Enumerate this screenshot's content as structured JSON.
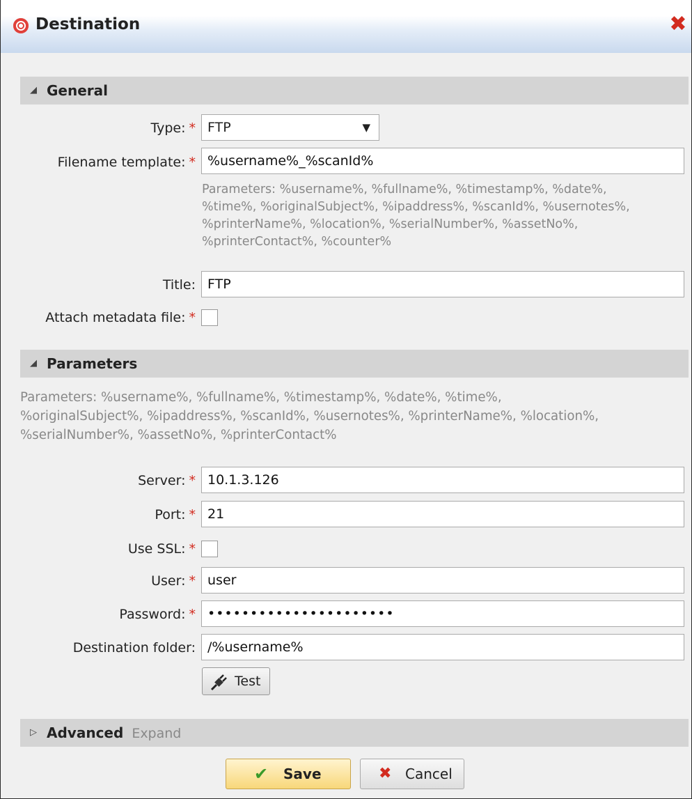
{
  "window": {
    "title": "Destination",
    "close_glyph": "✖"
  },
  "icons": {
    "title": "target-icon",
    "close": "close-icon",
    "test": "plug-icon",
    "save": "check-icon",
    "cancel": "x-icon"
  },
  "colors": {
    "required": "#d22b1f",
    "save_bg": "#f8d77a",
    "section_bg": "#d4d4d4"
  },
  "general": {
    "header": "General",
    "type": {
      "label": "Type:",
      "value": "FTP"
    },
    "filename_template": {
      "label": "Filename template:",
      "value": "%username%_%scanId%",
      "hint_lines": [
        "Parameters: %username%, %fullname%, %timestamp%, %date%,",
        "%time%, %originalSubject%, %ipaddress%, %scanId%, %usernotes%,",
        "%printerName%, %location%, %serialNumber%, %assetNo%,",
        "%printerContact%, %counter%"
      ]
    },
    "title": {
      "label": "Title:",
      "value": "FTP"
    },
    "attach_metadata": {
      "label": "Attach metadata file:",
      "checked": false
    }
  },
  "parameters": {
    "header": "Parameters",
    "hint_lines": [
      "Parameters: %username%, %fullname%, %timestamp%, %date%, %time%,",
      "%originalSubject%, %ipaddress%, %scanId%, %usernotes%, %printerName%, %location%,",
      "%serialNumber%, %assetNo%, %printerContact%"
    ],
    "server": {
      "label": "Server:",
      "value": "10.1.3.126"
    },
    "port": {
      "label": "Port:",
      "value": "21"
    },
    "use_ssl": {
      "label": "Use SSL:",
      "checked": false
    },
    "user": {
      "label": "User:",
      "value": "user"
    },
    "password": {
      "label": "Password:",
      "value": "••••••••••••••••••••••"
    },
    "destination_folder": {
      "label": "Destination folder:",
      "value": "/%username%"
    },
    "test_button": "Test"
  },
  "advanced": {
    "header": "Advanced",
    "expand": "Expand"
  },
  "footer": {
    "save": "Save",
    "cancel": "Cancel"
  },
  "glyphs": {
    "collapse": "◢",
    "expand": "▷",
    "dropdown": "▼",
    "required": "*"
  }
}
